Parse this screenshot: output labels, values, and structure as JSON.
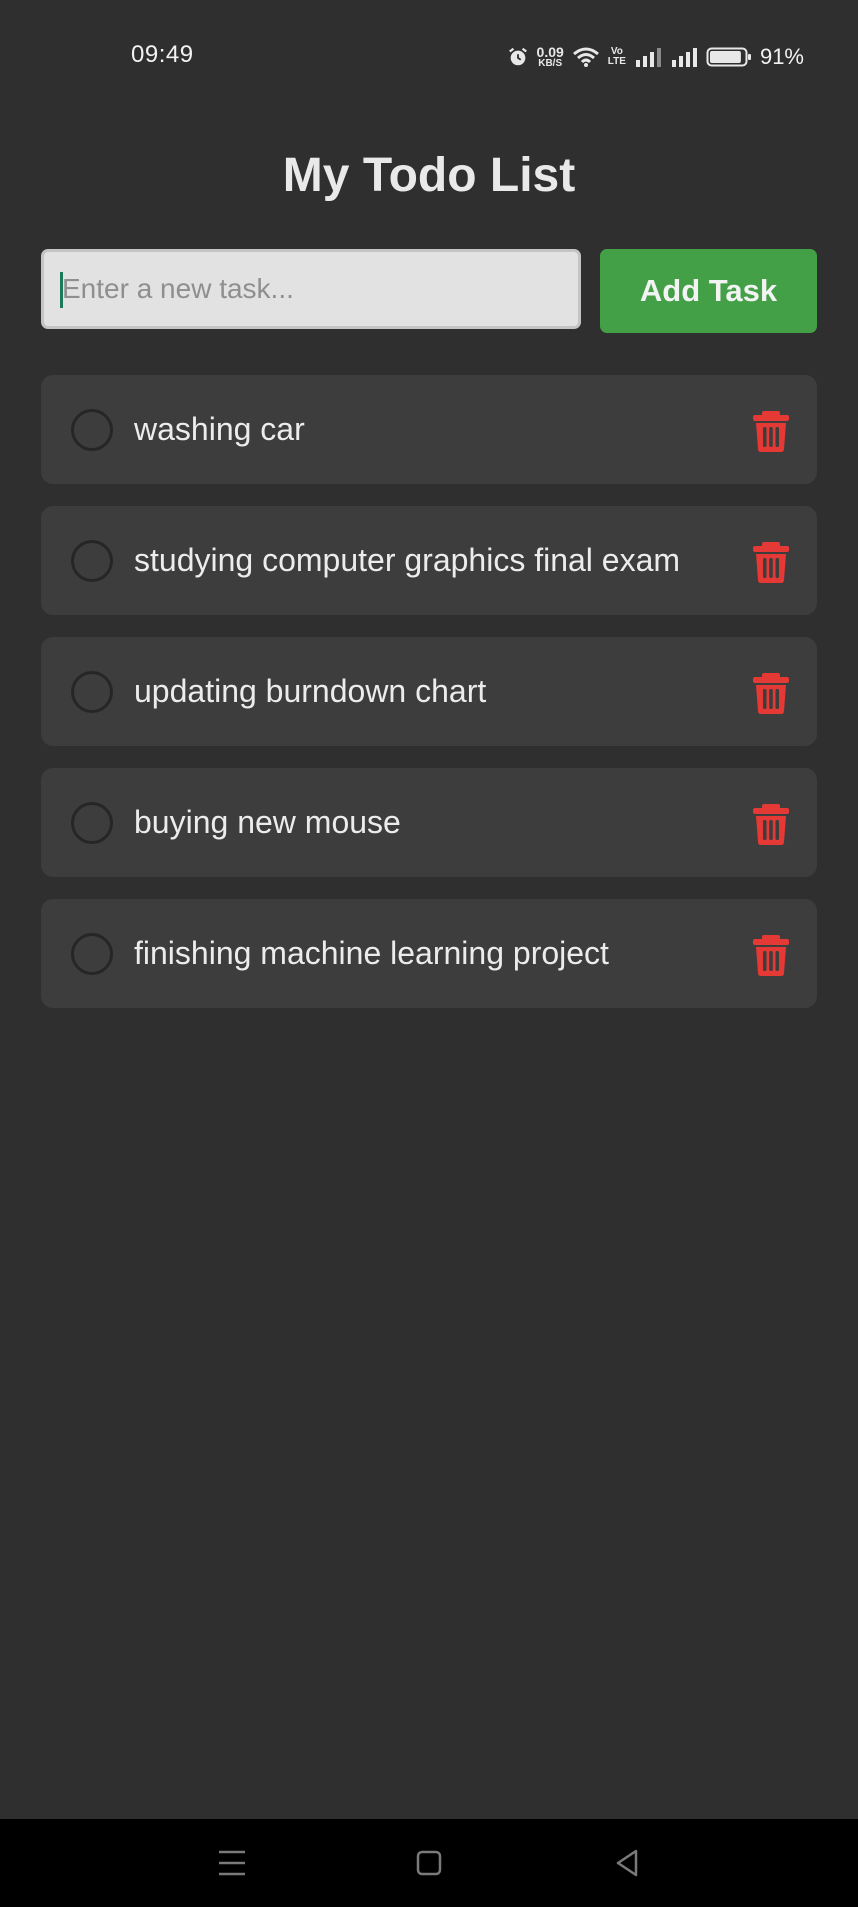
{
  "status_bar": {
    "time": "09:49",
    "net_speed": "0.09",
    "net_speed_unit": "KB/S",
    "volte_top": "Vo",
    "volte_bottom": "LTE",
    "battery_percent": "91%",
    "battery_level": 0.91
  },
  "header": {
    "title": "My Todo List"
  },
  "new_task": {
    "placeholder": "Enter a new task...",
    "value": "",
    "add_label": "Add Task"
  },
  "tasks": [
    {
      "text": "washing car",
      "done": false
    },
    {
      "text": "studying computer graphics final exam",
      "done": false
    },
    {
      "text": "updating burndown chart",
      "done": false
    },
    {
      "text": "buying new mouse",
      "done": false
    },
    {
      "text": "finishing machine learning project",
      "done": false
    }
  ],
  "icons": {
    "delete": "trash-icon",
    "check": "circle-checkbox-icon",
    "nav_menu": "menu-icon",
    "nav_home": "home-square-icon",
    "nav_back": "back-triangle-icon"
  },
  "colors": {
    "background": "#2f2f2f",
    "card": "#3d3d3d",
    "accent_green": "#43a047",
    "delete_red": "#e53935",
    "text": "#e9e9e9"
  }
}
